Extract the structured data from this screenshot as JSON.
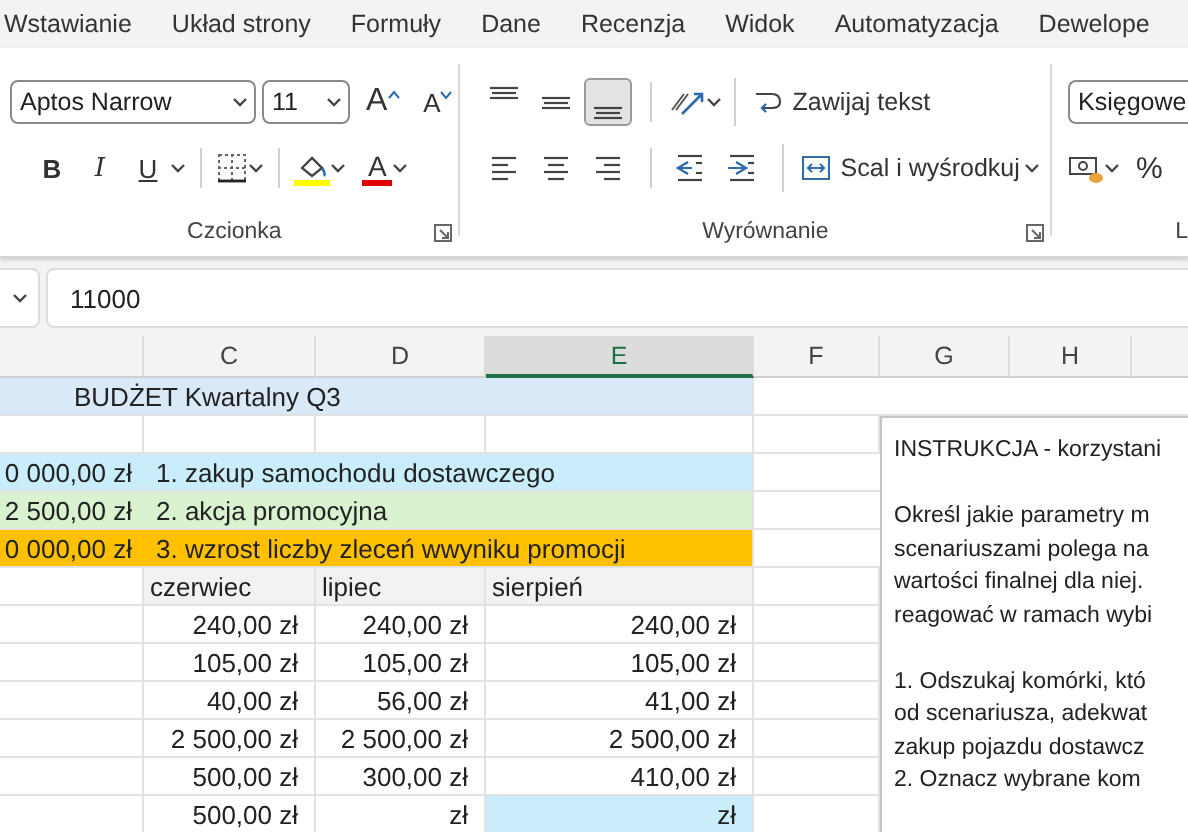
{
  "ribbon_tabs": [
    {
      "label": "Wstawianie"
    },
    {
      "label": "Układ strony"
    },
    {
      "label": "Formuły"
    },
    {
      "label": "Dane"
    },
    {
      "label": "Recenzja"
    },
    {
      "label": "Widok"
    },
    {
      "label": "Automatyzacja"
    },
    {
      "label": "Dewelope"
    }
  ],
  "font_group": {
    "font": "Aptos Narrow",
    "size": "11",
    "grow": "A",
    "shrink": "A",
    "bold": "B",
    "italic": "I",
    "underline": "U",
    "font_color": "A",
    "label": "Czcionka"
  },
  "alignment_group": {
    "vertical": [
      {
        "kind": "top",
        "selected": false
      },
      {
        "kind": "middle",
        "selected": false
      },
      {
        "kind": "bottom",
        "selected": true
      }
    ],
    "wrap_text": "Zawijaj tekst",
    "merge": "Scal i wyśrodkuj",
    "label": "Wyrównanie"
  },
  "number_group": {
    "format": "Księgowe",
    "percent": "%",
    "label": "L"
  },
  "formula_bar": {
    "value": "11000"
  },
  "sheet": {
    "columns": [
      {
        "selected": false
      },
      {
        "label": "C",
        "selected": false
      },
      {
        "label": "D",
        "selected": false
      },
      {
        "label": "E",
        "selected": true
      },
      {
        "label": "F",
        "selected": false
      },
      {
        "label": "G",
        "selected": false
      },
      {
        "label": "H",
        "selected": false
      }
    ],
    "rows": [
      {
        "kind": "title",
        "text": "BUDŻET Kwartalny Q3",
        "color": "#dae9f8"
      },
      {
        "kind": "blank"
      },
      {
        "kind": "scenario",
        "amount": "0 000,00 zł",
        "label": "1. zakup samochodu dostawczego",
        "color": "#caedfb"
      },
      {
        "kind": "scenario",
        "amount": "2 500,00 zł",
        "label": "2. akcja promocyjna",
        "color": "#daf2d0"
      },
      {
        "kind": "scenario",
        "amount": "0 000,00 zł",
        "label": "3. wzrost liczby zleceń wwyniku promocji",
        "color": "#ffc000"
      },
      {
        "kind": "header",
        "cells": [
          "czerwiec",
          "lipiec",
          "sierpień"
        ]
      },
      {
        "kind": "values",
        "cells": [
          "240,00 zł",
          "240,00 zł",
          "240,00 zł"
        ],
        "highlight_last": false
      },
      {
        "kind": "values",
        "cells": [
          "105,00 zł",
          "105,00 zł",
          "105,00 zł"
        ],
        "highlight_last": false
      },
      {
        "kind": "values",
        "cells": [
          "40,00 zł",
          "56,00 zł",
          "41,00 zł"
        ],
        "highlight_last": false
      },
      {
        "kind": "values",
        "cells": [
          "2 500,00 zł",
          "2 500,00 zł",
          "2 500,00 zł"
        ],
        "highlight_last": false
      },
      {
        "kind": "values",
        "cells": [
          "500,00 zł",
          "300,00 zł",
          "410,00 zł"
        ],
        "highlight_last": false
      },
      {
        "kind": "values",
        "cells": [
          "500,00 zł",
          "zł",
          "zł"
        ],
        "highlight_last": true
      }
    ]
  },
  "instruction_box": {
    "paragraphs": [
      [
        "INSTRUKCJA - korzystani"
      ],
      [
        "Określ jakie parametry m",
        "scenariuszami polega na",
        "wartości finalnej dla niej.",
        "reagować w ramach wybi"
      ],
      [
        "1.  Odszukaj komórki, któ",
        "od scenariusza, adekwat",
        "zakup pojazdu dostawcz",
        "2.  Oznacz wybrane kom"
      ]
    ]
  }
}
